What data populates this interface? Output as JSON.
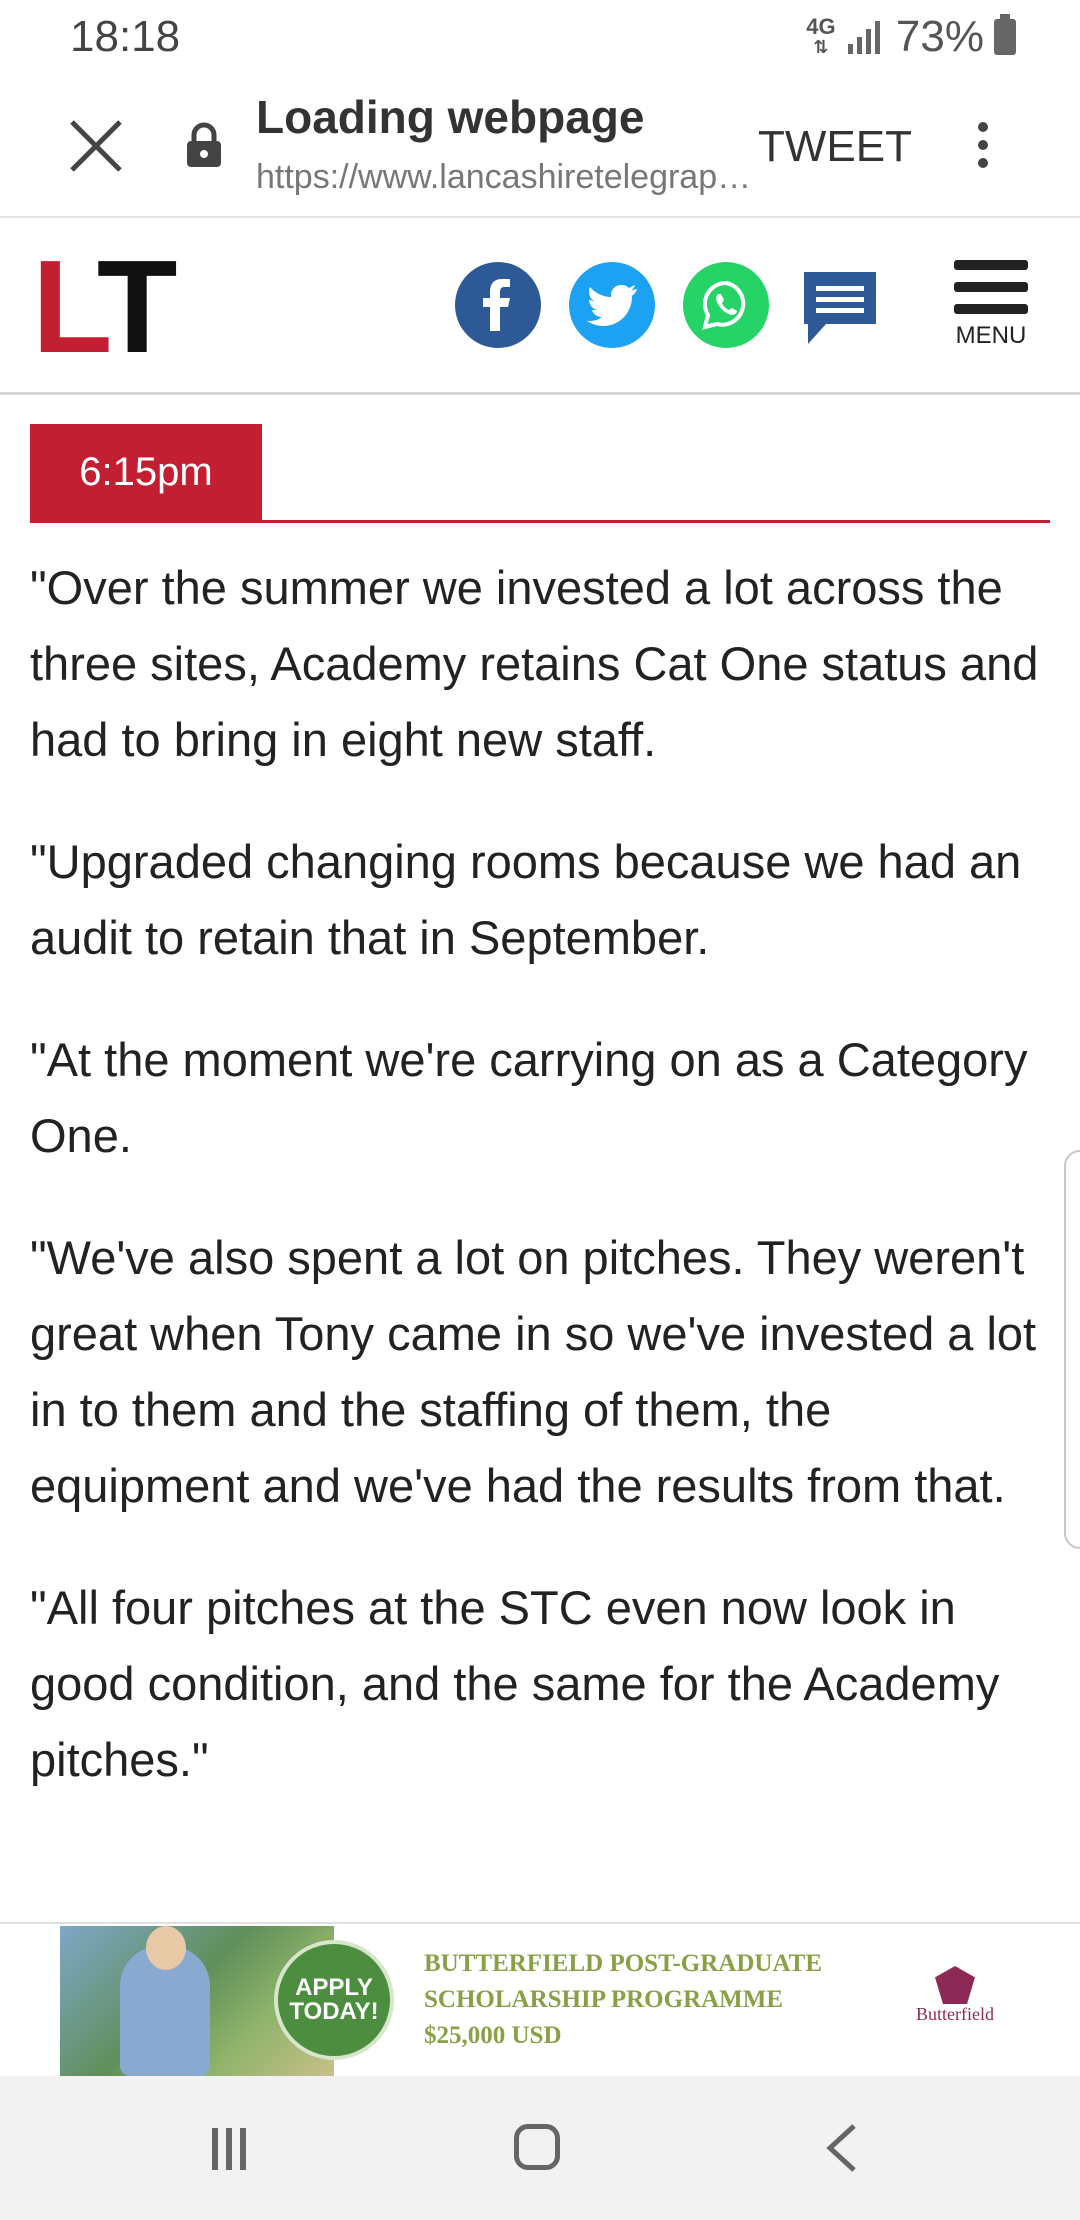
{
  "status_bar": {
    "time": "18:18",
    "network": "4G",
    "battery": "73%"
  },
  "browser": {
    "title": "Loading webpage",
    "url": "https://www.lancashiretelegrap…",
    "tweet_label": "TWEET",
    "icons": [
      "close-icon",
      "lock-icon",
      "more-vert-icon"
    ]
  },
  "site_header": {
    "logo_l": "L",
    "logo_t": "T",
    "menu_label": "MENU",
    "share_icons": [
      "facebook-icon",
      "twitter-icon",
      "whatsapp-icon",
      "comment-icon"
    ],
    "colors": {
      "brand_red": "#c21f32",
      "facebook": "#2d5a96",
      "twitter": "#1da1f2",
      "whatsapp": "#25d366"
    }
  },
  "article": {
    "timestamp": "6:15pm",
    "paragraphs": [
      "\"Over the summer we invested a lot across the three sites, Academy retains Cat One status and had to bring in eight new staff.",
      "\"Upgraded changing rooms because we had an audit to retain that in September.",
      "\"At the moment we're carrying on as a Category One.",
      "\"We've also spent a lot on pitches. They weren't great when Tony came in so we've invested a lot in to them and the staffing of them, the equipment and we've had the results from that.",
      "\"All four pitches at the STC even now look in good condition, and the same for the Academy pitches.\""
    ]
  },
  "ad": {
    "badge_line1": "APPLY",
    "badge_line2": "TODAY!",
    "line1": "BUTTERFIELD POST-GRADUATE",
    "line2": "SCHOLARSHIP PROGRAMME",
    "line3": "$25,000 USD",
    "logo_text": "Butterfield"
  },
  "nav_bar": {
    "icons": [
      "recent-apps-icon",
      "home-icon",
      "back-icon"
    ]
  }
}
